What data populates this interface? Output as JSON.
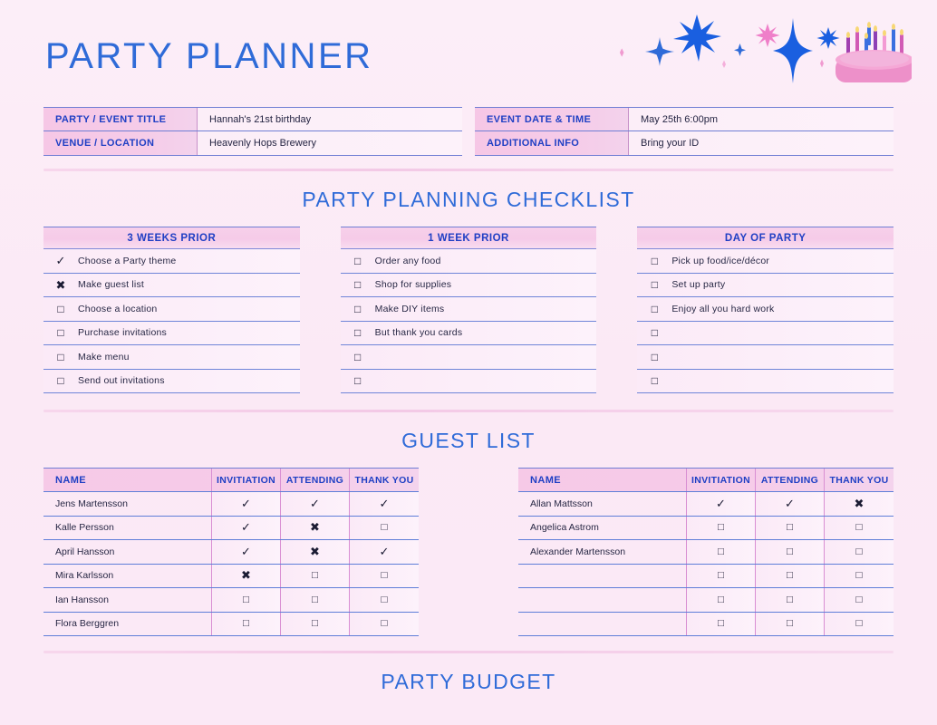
{
  "header": {
    "title": "PARTY PLANNER",
    "decor_icons": [
      "sparkle-icon",
      "sparkle-icon",
      "sparkle-icon",
      "sparkle-icon",
      "sparkle-icon",
      "birthday-cake-icon"
    ],
    "colors": {
      "accent_blue": "#2f6bd8",
      "accent_pink": "#f06fc0",
      "label_blue": "#1f3fc4",
      "background": "#fbeaf6"
    }
  },
  "info": {
    "left": [
      {
        "label": "PARTY / EVENT TITLE",
        "value": "Hannah's 21st birthday"
      },
      {
        "label": "VENUE / LOCATION",
        "value": "Heavenly Hops Brewery"
      }
    ],
    "right": [
      {
        "label": "EVENT DATE & TIME",
        "value": "May 25th 6:00pm"
      },
      {
        "label": "ADDITIONAL INFO",
        "value": "Bring your ID"
      }
    ]
  },
  "checklist": {
    "heading": "PARTY PLANNING CHECKLIST",
    "columns": [
      {
        "title": "3 WEEKS PRIOR",
        "items": [
          {
            "state": "checked",
            "mark": "✓",
            "label": "Choose a Party theme"
          },
          {
            "state": "crossed",
            "mark": "✖",
            "label": "Make guest list"
          },
          {
            "state": "empty",
            "mark": "□",
            "label": "Choose a location"
          },
          {
            "state": "empty",
            "mark": "□",
            "label": "Purchase invitations"
          },
          {
            "state": "empty",
            "mark": "□",
            "label": "Make menu"
          },
          {
            "state": "empty",
            "mark": "□",
            "label": "Send out invitations"
          }
        ]
      },
      {
        "title": "1 WEEK PRIOR",
        "items": [
          {
            "state": "empty",
            "mark": "□",
            "label": "Order any food"
          },
          {
            "state": "empty",
            "mark": "□",
            "label": "Shop for supplies"
          },
          {
            "state": "empty",
            "mark": "□",
            "label": "Make DIY items"
          },
          {
            "state": "empty",
            "mark": "□",
            "label": "But thank you cards"
          },
          {
            "state": "empty",
            "mark": "□",
            "label": ""
          },
          {
            "state": "empty",
            "mark": "□",
            "label": ""
          }
        ]
      },
      {
        "title": "DAY OF PARTY",
        "items": [
          {
            "state": "empty",
            "mark": "□",
            "label": "Pick up food/ice/décor"
          },
          {
            "state": "empty",
            "mark": "□",
            "label": "Set up party"
          },
          {
            "state": "empty",
            "mark": "□",
            "label": "Enjoy all you hard work"
          },
          {
            "state": "empty",
            "mark": "□",
            "label": ""
          },
          {
            "state": "empty",
            "mark": "□",
            "label": ""
          },
          {
            "state": "empty",
            "mark": "□",
            "label": ""
          }
        ]
      }
    ]
  },
  "guest_list": {
    "heading": "GUEST LIST",
    "columns": [
      "NAME",
      "INVITIATION",
      "ATTENDING",
      "THANK YOU"
    ],
    "tables": [
      {
        "rows": [
          {
            "name": "Jens Martensson",
            "invitation": "✓",
            "attending": "✓",
            "thank_you": "✓"
          },
          {
            "name": "Kalle Persson",
            "invitation": "✓",
            "attending": "✖",
            "thank_you": "□"
          },
          {
            "name": "April Hansson",
            "invitation": "✓",
            "attending": "✖",
            "thank_you": "✓"
          },
          {
            "name": "Mira Karlsson",
            "invitation": "✖",
            "attending": "□",
            "thank_you": "□"
          },
          {
            "name": "Ian Hansson",
            "invitation": "□",
            "attending": "□",
            "thank_you": "□"
          },
          {
            "name": "Flora Berggren",
            "invitation": "□",
            "attending": "□",
            "thank_you": "□"
          }
        ]
      },
      {
        "rows": [
          {
            "name": "Allan Mattsson",
            "invitation": "✓",
            "attending": "✓",
            "thank_you": "✖"
          },
          {
            "name": "Angelica Astrom",
            "invitation": "□",
            "attending": "□",
            "thank_you": "□"
          },
          {
            "name": "Alexander Martensson",
            "invitation": "□",
            "attending": "□",
            "thank_you": "□"
          },
          {
            "name": "",
            "invitation": "□",
            "attending": "□",
            "thank_you": "□"
          },
          {
            "name": "",
            "invitation": "□",
            "attending": "□",
            "thank_you": "□"
          },
          {
            "name": "",
            "invitation": "□",
            "attending": "□",
            "thank_you": "□"
          }
        ]
      }
    ]
  },
  "budget": {
    "heading": "PARTY BUDGET"
  }
}
